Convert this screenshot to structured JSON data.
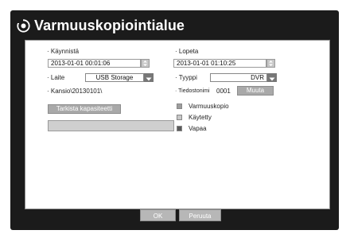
{
  "dialog": {
    "title": "Varmuuskopiointialue",
    "start": {
      "label": "· Käynnistä",
      "value": "2013-01-01 00:01:06"
    },
    "end": {
      "label": "· Lopeta",
      "value": "2013-01-01 01:10:25"
    },
    "device": {
      "label": "· Laite",
      "value": "USB Storage"
    },
    "type": {
      "label": "· Tyyppi",
      "value": "DVR"
    },
    "folder": {
      "label": "· Kansio\\20130101\\"
    },
    "filename": {
      "label": "· Tiedostonimi",
      "value": "0001",
      "button": "Muuta"
    },
    "check_capacity_button": "Tarkista kapasiteetti",
    "legend": [
      {
        "label": "Varmuuskopio",
        "color": "#9d9d9d"
      },
      {
        "label": "Käytetty",
        "color": "#c8c8c8"
      },
      {
        "label": "Vapaa",
        "color": "#5a5a5a"
      }
    ],
    "ok_button": "OK",
    "cancel_button": "Peruuta"
  }
}
